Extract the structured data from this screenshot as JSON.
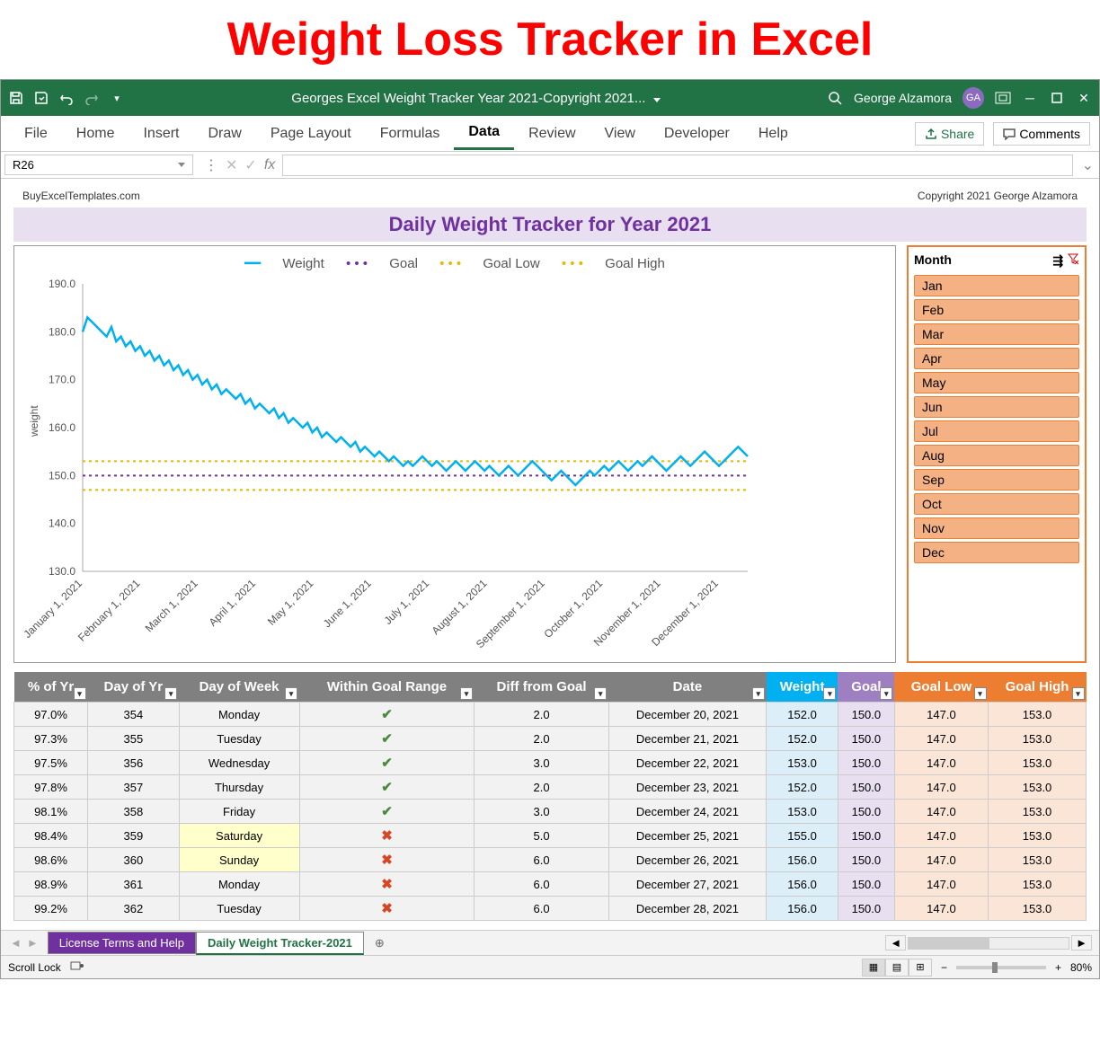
{
  "headline": "Weight Loss Tracker in Excel",
  "titlebar": {
    "doc_title": "Georges Excel Weight Tracker Year 2021-Copyright 2021...",
    "user_name": "George Alzamora",
    "user_initials": "GA"
  },
  "ribbon": {
    "tabs": [
      "File",
      "Home",
      "Insert",
      "Draw",
      "Page Layout",
      "Formulas",
      "Data",
      "Review",
      "View",
      "Developer",
      "Help"
    ],
    "active": "Data",
    "share": "Share",
    "comments": "Comments"
  },
  "formula_bar": {
    "name_box": "R26",
    "fx_label": "fx"
  },
  "sheet": {
    "left_info": "BuyExcelTemplates.com",
    "right_info": "Copyright 2021  George Alzamora",
    "chart_title": "Daily Weight Tracker for Year 2021"
  },
  "legend": {
    "weight": "Weight",
    "goal": "Goal",
    "goal_low": "Goal Low",
    "goal_high": "Goal High"
  },
  "slicer": {
    "header": "Month",
    "items": [
      "Jan",
      "Feb",
      "Mar",
      "Apr",
      "May",
      "Jun",
      "Jul",
      "Aug",
      "Sep",
      "Oct",
      "Nov",
      "Dec"
    ]
  },
  "chart_data": {
    "type": "line",
    "ylabel": "weight",
    "ylim": [
      130,
      190
    ],
    "yticks": [
      130,
      140,
      150,
      160,
      170,
      180,
      190
    ],
    "xticks": [
      "January 1, 2021",
      "February 1, 2021",
      "March 1, 2021",
      "April 1, 2021",
      "May 1, 2021",
      "June 1, 2021",
      "July 1, 2021",
      "August 1, 2021",
      "September 1, 2021",
      "October 1, 2021",
      "November 1, 2021",
      "December 1, 2021"
    ],
    "goal": 150,
    "goal_low": 147,
    "goal_high": 153,
    "series": [
      {
        "name": "Weight",
        "values": [
          180,
          183,
          182,
          181,
          180,
          179,
          181,
          178,
          179,
          177,
          178,
          176,
          177,
          175,
          176,
          174,
          175,
          173,
          174,
          172,
          173,
          171,
          172,
          170,
          171,
          169,
          170,
          168,
          169,
          167,
          168,
          167,
          166,
          167,
          165,
          166,
          164,
          165,
          164,
          163,
          164,
          162,
          163,
          161,
          162,
          161,
          160,
          161,
          159,
          160,
          158,
          159,
          158,
          157,
          158,
          157,
          156,
          157,
          155,
          156,
          155,
          154,
          155,
          154,
          153,
          154,
          153,
          152,
          153,
          152,
          153,
          154,
          153,
          152,
          153,
          152,
          151,
          152,
          153,
          152,
          151,
          152,
          153,
          152,
          151,
          152,
          151,
          150,
          151,
          152,
          151,
          150,
          151,
          152,
          153,
          152,
          151,
          150,
          149,
          150,
          151,
          150,
          149,
          148,
          149,
          150,
          151,
          150,
          151,
          152,
          151,
          152,
          153,
          152,
          151,
          152,
          153,
          152,
          153,
          154,
          153,
          152,
          151,
          152,
          153,
          154,
          153,
          152,
          153,
          154,
          155,
          154,
          153,
          152,
          153,
          154,
          155,
          156,
          155,
          154
        ]
      }
    ]
  },
  "table": {
    "headers": [
      "% of Yr",
      "Day of Yr",
      "Day of Week",
      "Within Goal Range",
      "Diff from Goal",
      "Date",
      "Weight",
      "Goal",
      "Goal Low",
      "Goal High"
    ],
    "rows": [
      {
        "pct": "97.0%",
        "doy": "354",
        "dow": "Monday",
        "weekend": false,
        "in": true,
        "diff": "2.0",
        "date": "December 20, 2021",
        "w": "152.0",
        "g": "150.0",
        "lo": "147.0",
        "hi": "153.0"
      },
      {
        "pct": "97.3%",
        "doy": "355",
        "dow": "Tuesday",
        "weekend": false,
        "in": true,
        "diff": "2.0",
        "date": "December 21, 2021",
        "w": "152.0",
        "g": "150.0",
        "lo": "147.0",
        "hi": "153.0"
      },
      {
        "pct": "97.5%",
        "doy": "356",
        "dow": "Wednesday",
        "weekend": false,
        "in": true,
        "diff": "3.0",
        "date": "December 22, 2021",
        "w": "153.0",
        "g": "150.0",
        "lo": "147.0",
        "hi": "153.0"
      },
      {
        "pct": "97.8%",
        "doy": "357",
        "dow": "Thursday",
        "weekend": false,
        "in": true,
        "diff": "2.0",
        "date": "December 23, 2021",
        "w": "152.0",
        "g": "150.0",
        "lo": "147.0",
        "hi": "153.0"
      },
      {
        "pct": "98.1%",
        "doy": "358",
        "dow": "Friday",
        "weekend": false,
        "in": true,
        "diff": "3.0",
        "date": "December 24, 2021",
        "w": "153.0",
        "g": "150.0",
        "lo": "147.0",
        "hi": "153.0"
      },
      {
        "pct": "98.4%",
        "doy": "359",
        "dow": "Saturday",
        "weekend": true,
        "in": false,
        "diff": "5.0",
        "date": "December 25, 2021",
        "w": "155.0",
        "g": "150.0",
        "lo": "147.0",
        "hi": "153.0"
      },
      {
        "pct": "98.6%",
        "doy": "360",
        "dow": "Sunday",
        "weekend": true,
        "in": false,
        "diff": "6.0",
        "date": "December 26, 2021",
        "w": "156.0",
        "g": "150.0",
        "lo": "147.0",
        "hi": "153.0"
      },
      {
        "pct": "98.9%",
        "doy": "361",
        "dow": "Monday",
        "weekend": false,
        "in": false,
        "diff": "6.0",
        "date": "December 27, 2021",
        "w": "156.0",
        "g": "150.0",
        "lo": "147.0",
        "hi": "153.0"
      },
      {
        "pct": "99.2%",
        "doy": "362",
        "dow": "Tuesday",
        "weekend": false,
        "in": false,
        "diff": "6.0",
        "date": "December 28, 2021",
        "w": "156.0",
        "g": "150.0",
        "lo": "147.0",
        "hi": "153.0"
      }
    ]
  },
  "sheet_tabs": {
    "tab1": "License Terms and Help",
    "tab2": "Daily Weight Tracker-2021"
  },
  "status": {
    "left": "Scroll Lock",
    "zoom": "80%"
  }
}
